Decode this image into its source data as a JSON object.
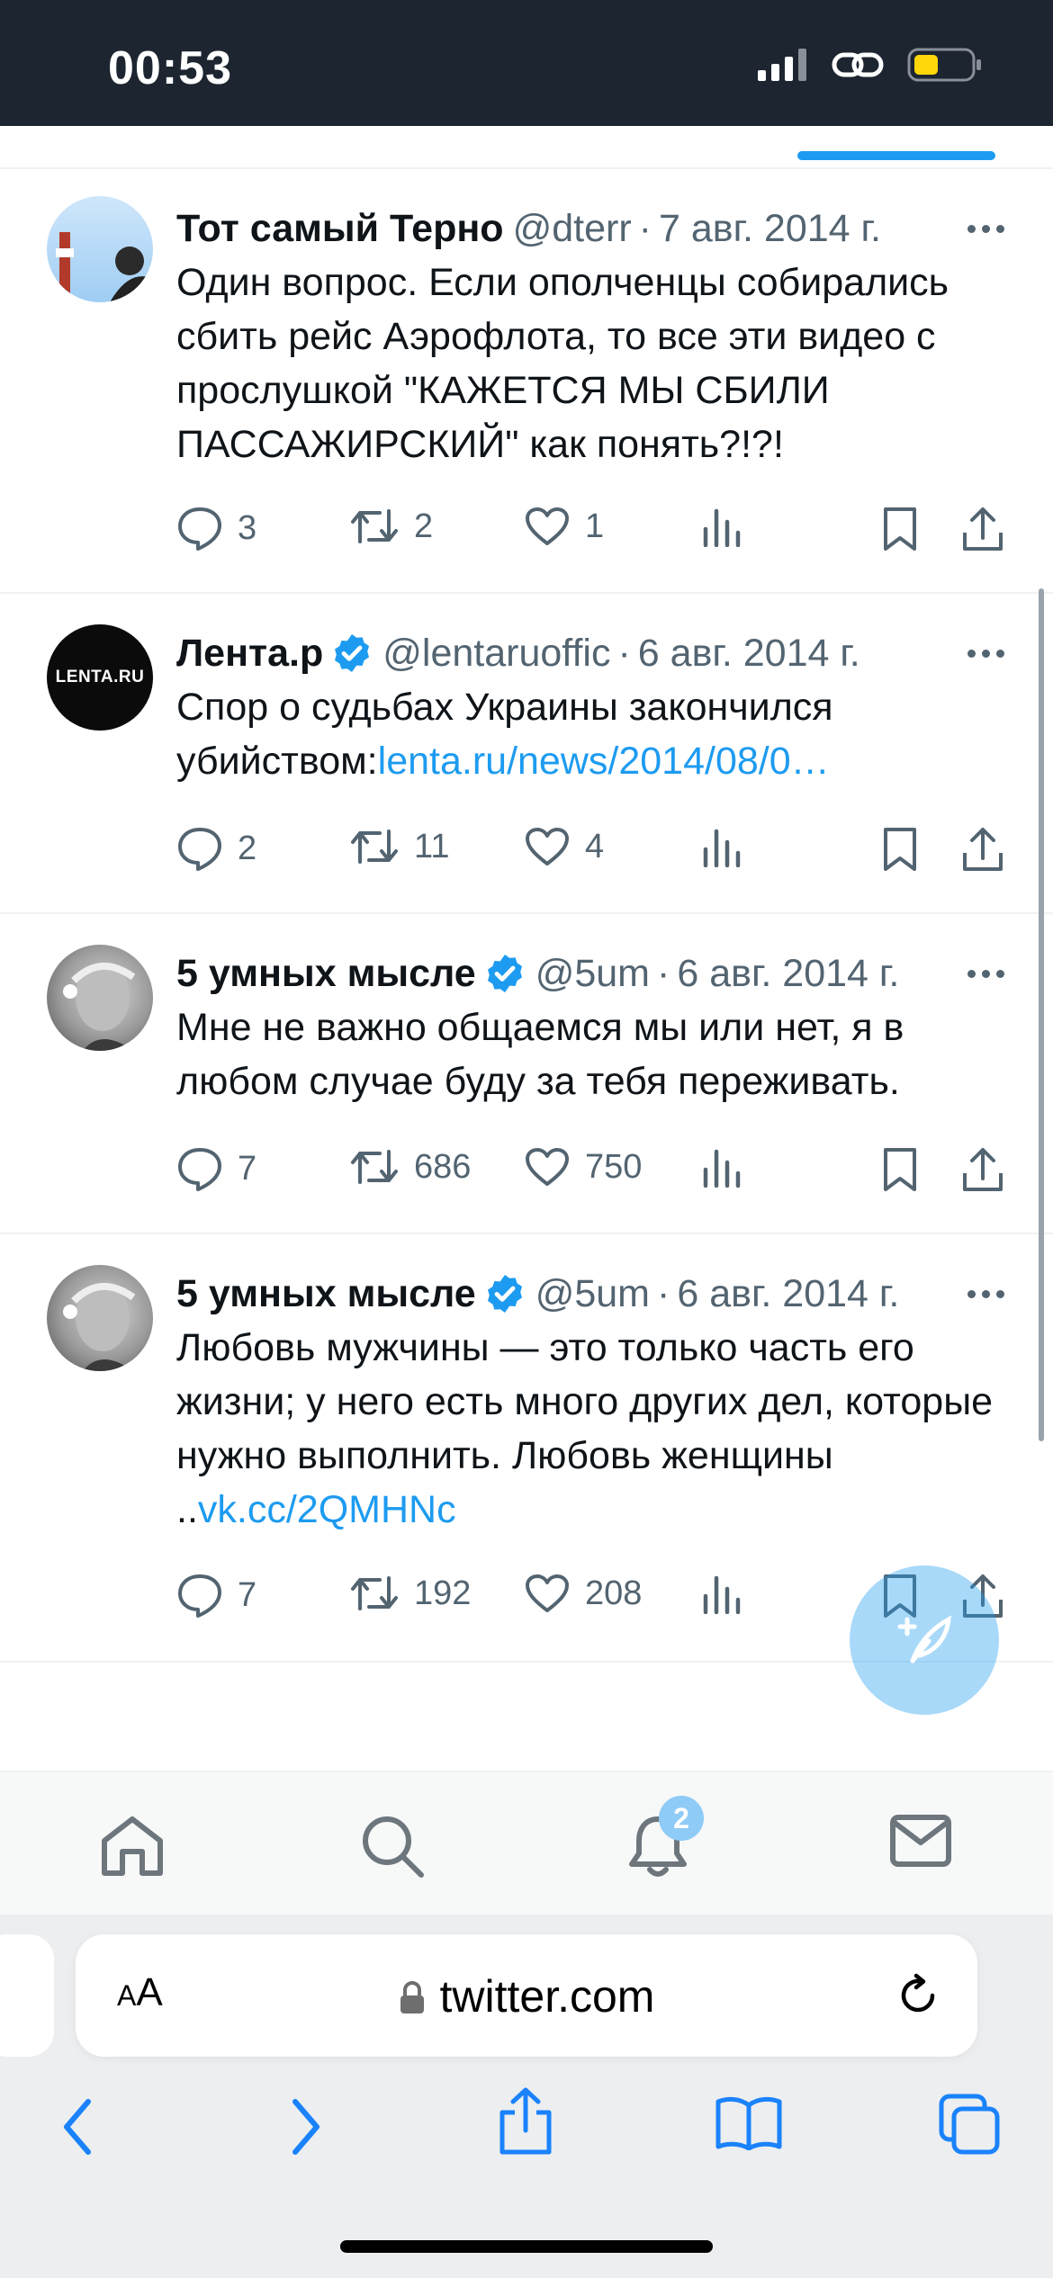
{
  "status_bar": {
    "time": "00:53"
  },
  "colors": {
    "accent": "#1d9bf0",
    "secondary_text": "#536471",
    "status_bg": "#1c2530",
    "battery_fill": "#ffd60a"
  },
  "tweets": [
    {
      "name": "Тот самый Терно",
      "verified": false,
      "handle": "@dterr",
      "date": "7 авг. 2014 г.",
      "text": "Один вопрос. Если ополченцы собирались сбить рейс Аэрофлота, то все эти видео с прослушкой \"КАЖЕТСЯ МЫ СБИЛИ ПАССАЖИРСКИЙ\" как понять?!?!",
      "link": "",
      "replies": "3",
      "retweets": "2",
      "likes": "1"
    },
    {
      "name": "Лента.р",
      "verified": true,
      "handle": "@lentaruoffic",
      "date": "6 авг. 2014 г.",
      "text": "Спор о судьбах Украины закончился убийством:",
      "link": "lenta.ru/news/2014/08/0…",
      "replies": "2",
      "retweets": "11",
      "likes": "4",
      "avatar_text": "LENTA.RU"
    },
    {
      "name": "5 умных мысле",
      "verified": true,
      "handle": "@5um",
      "date": "6 авг. 2014 г.",
      "text": "Мне не важно общаемся мы или нет, я в любом случае буду за тебя переживать.",
      "link": "",
      "replies": "7",
      "retweets": "686",
      "likes": "750"
    },
    {
      "name": "5 умных мысле",
      "verified": true,
      "handle": "@5um",
      "date": "6 авг. 2014 г.",
      "text": "Любовь мужчины — это только часть его жизни; у него есть много других дел, которые нужно выполнить. Любовь женщины ..",
      "link": "vk.cc/2QMHNc",
      "replies": "7",
      "retweets": "192",
      "likes": "208"
    }
  ],
  "bottom_nav": {
    "items": [
      "home-icon",
      "search-icon",
      "notifications-icon",
      "messages-icon"
    ],
    "notification_count": "2"
  },
  "safari": {
    "text_size_label_small": "A",
    "text_size_label_large": "A",
    "url": "twitter.com"
  }
}
